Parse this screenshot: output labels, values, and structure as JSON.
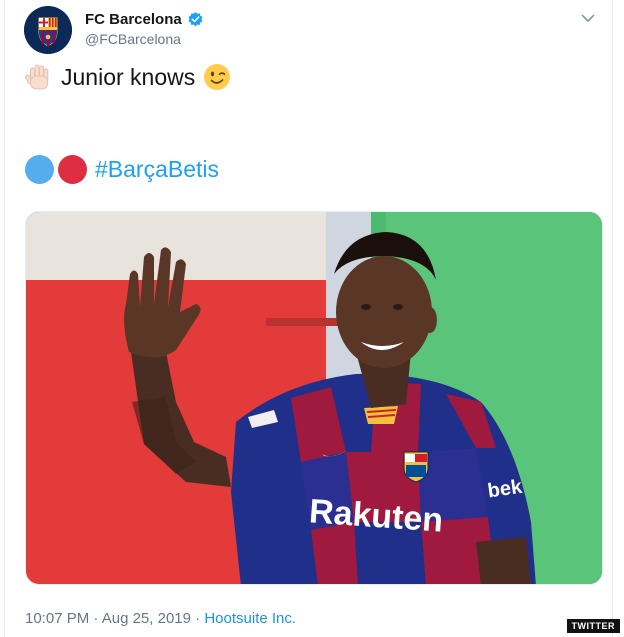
{
  "account": {
    "name": "FC Barcelona",
    "handle": "@FCBarcelona",
    "avatar_icon": "fc-barcelona-crest"
  },
  "tweet": {
    "line1_text": "Junior knows",
    "line1_lead_emoji": "raised-hand",
    "line1_trail_emoji": "winking-face",
    "line2_dots": [
      "#55acee",
      "#dd2e44"
    ],
    "hashtag": "#BarçaBetis",
    "media_alt_icon": "player-waving-photo",
    "media_text": {
      "sponsor": "Rakuten",
      "sleeve": "bek"
    }
  },
  "meta": {
    "time": "10:07 PM",
    "sep": " · ",
    "date": "Aug 25, 2019",
    "sep2": " · ",
    "source": "Hootsuite Inc."
  },
  "watermark": "TWITTER",
  "colors": {
    "link": "#1da1f2",
    "secondary_text": "#657786",
    "brand_blue": "#0b2a57"
  }
}
